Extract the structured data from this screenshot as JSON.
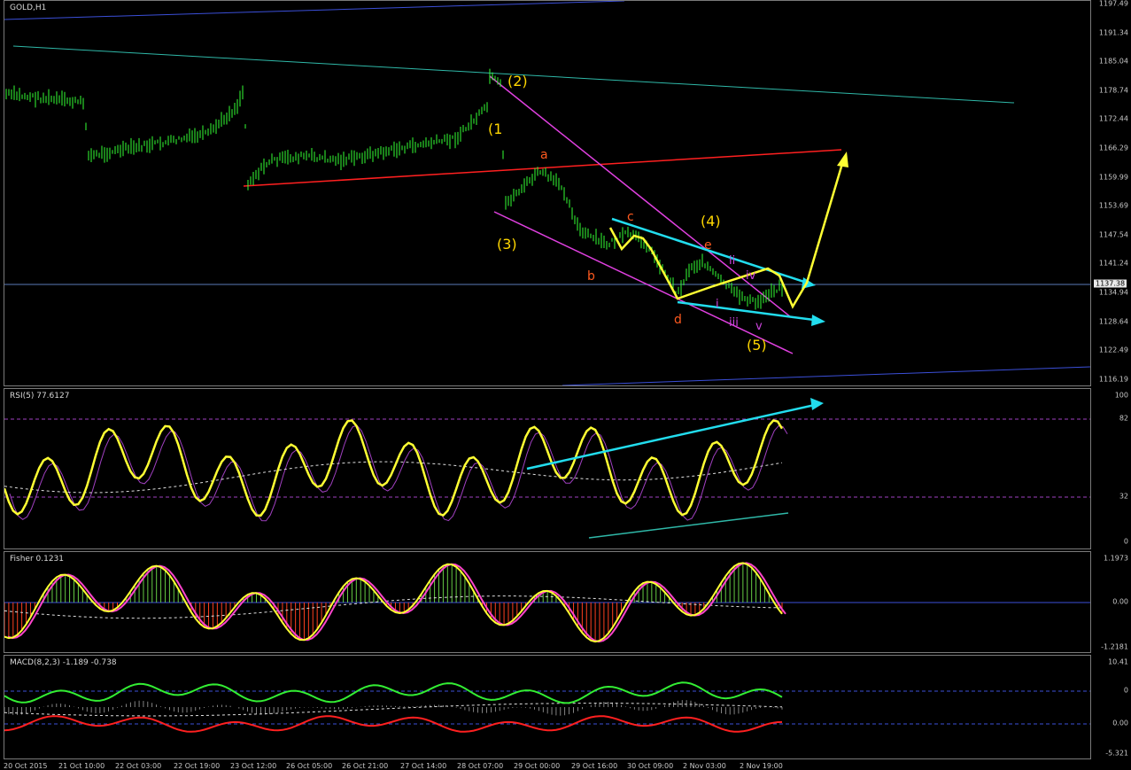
{
  "main_chart": {
    "title": "GOLD,H1",
    "current_price": "1137.38",
    "price_axis": [
      "1197.49",
      "1191.34",
      "1185.04",
      "1178.74",
      "1172.44",
      "1166.29",
      "1159.99",
      "1153.69",
      "1147.54",
      "1141.24",
      "1134.94",
      "1128.64",
      "1122.49",
      "1116.19"
    ],
    "wave_labels": {
      "w1": "(1",
      "w2": "(2)",
      "w3": "(3)",
      "w4": "(4)",
      "w5": "(5)",
      "a": "a",
      "b": "b",
      "c": "c",
      "d": "d",
      "e": "e",
      "i": "i",
      "ii": "ii",
      "iii": "iii",
      "iv": "iv",
      "v": "v"
    },
    "colors": {
      "candles": "#33ff33",
      "wave_major": "#ffd700",
      "wave_abc": "#ff5a1f",
      "wave_sub": "#cc44dd",
      "channel": "#e040e0",
      "trend_red": "#ff2020",
      "arrows": "#ffff33",
      "cyan": "#22ddee"
    }
  },
  "rsi": {
    "title": "RSI(5) 77.6127",
    "levels": [
      "100",
      "82",
      "32",
      "0"
    ]
  },
  "fisher": {
    "title": "Fisher 0.1231",
    "levels": [
      "1.1973",
      "0.00",
      "-1.2181"
    ]
  },
  "macd": {
    "title": "MACD(8,2,3) -1.189 -0.738",
    "levels": [
      "10.41",
      "0",
      "0.00",
      "-5.321"
    ]
  },
  "time_axis": [
    "20 Oct 2015",
    "21 Oct 10:00",
    "22 Oct 03:00",
    "22 Oct 19:00",
    "23 Oct 12:00",
    "26 Oct 05:00",
    "26 Oct 21:00",
    "27 Oct 14:00",
    "28 Oct 07:00",
    "29 Oct 00:00",
    "29 Oct 16:00",
    "30 Oct 09:00",
    "2 Nov 03:00",
    "2 Nov 19:00"
  ]
}
